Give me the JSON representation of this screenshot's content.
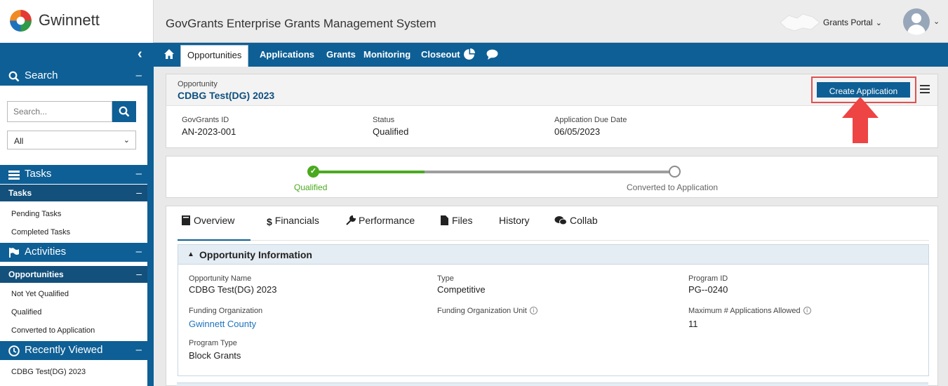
{
  "header": {
    "brand": "Gwinnett",
    "system_title": "GovGrants Enterprise Grants Management System",
    "portal_label": "Grants Portal"
  },
  "nav": {
    "items": [
      "Opportunities",
      "Applications",
      "Grants",
      "Monitoring",
      "Closeout"
    ],
    "active": "Opportunities"
  },
  "sidebar": {
    "search_header": "Search",
    "search_placeholder": "Search...",
    "filter_value": "All",
    "tasks_header": "Tasks",
    "tasks_sub": "Tasks",
    "tasks_links": [
      "Pending Tasks",
      "Completed Tasks"
    ],
    "activities_header": "Activities",
    "activities_sub": "Opportunities",
    "activities_links": [
      "Not Yet Qualified",
      "Qualified",
      "Converted to Application"
    ],
    "recent_header": "Recently Viewed",
    "recent_links": [
      "CDBG Test(DG) 2023"
    ]
  },
  "opportunity": {
    "kicker": "Opportunity",
    "title": "CDBG Test(DG) 2023",
    "create_button": "Create Application",
    "meta": [
      {
        "label": "GovGrants ID",
        "value": "AN-2023-001"
      },
      {
        "label": "Status",
        "value": "Qualified"
      },
      {
        "label": "Application Due Date",
        "value": "06/05/2023"
      }
    ]
  },
  "progress": {
    "steps": [
      "Qualified",
      "Converted to Application"
    ],
    "completed_fraction": 0.3
  },
  "tabs": [
    "Overview",
    "Financials",
    "Performance",
    "Files",
    "History",
    "Collab"
  ],
  "active_tab": "Overview",
  "section": {
    "title": "Opportunity Information",
    "fields": {
      "opportunity_name": {
        "label": "Opportunity Name",
        "value": "CDBG Test(DG) 2023"
      },
      "type": {
        "label": "Type",
        "value": "Competitive"
      },
      "program_id": {
        "label": "Program ID",
        "value": "PG--0240"
      },
      "funding_org": {
        "label": "Funding Organization",
        "value": "Gwinnett County"
      },
      "funding_org_unit": {
        "label": "Funding Organization Unit",
        "value": ""
      },
      "max_apps": {
        "label": "Maximum # Applications Allowed",
        "value": "11"
      },
      "program_type": {
        "label": "Program Type",
        "value": "Block Grants"
      }
    }
  },
  "colors": {
    "primary": "#0e5f95",
    "success": "#4aaa1f",
    "highlight": "#e25050"
  }
}
